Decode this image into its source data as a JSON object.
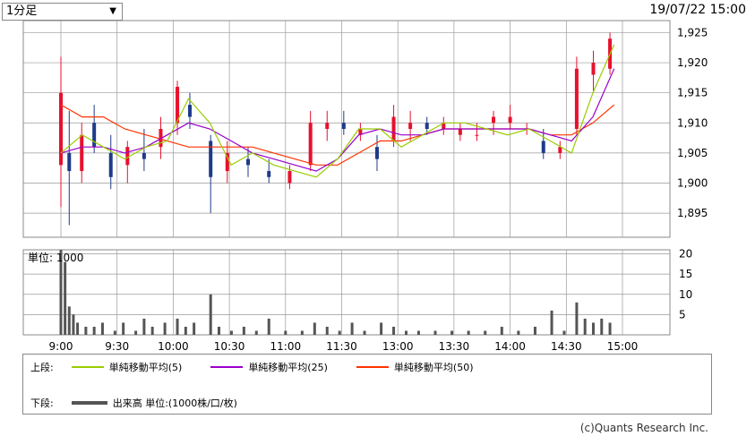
{
  "controls": {
    "interval_select": "1分足",
    "datetime": "19/07/22 15:00"
  },
  "legend": {
    "upper_label": "上段:",
    "lower_label": "下段:",
    "ma5": "単純移動平均(5)",
    "ma25": "単純移動平均(25)",
    "ma50": "単純移動平均(50)",
    "volume": "出来高 単位:(1000株/口/枚)"
  },
  "colors": {
    "up_candle": "#e8112d",
    "down_candle": "#1f3a8a",
    "ma5": "#99cc00",
    "ma25": "#9900cc",
    "ma50": "#ff3300",
    "volume_bar": "#555555",
    "grid": "#999999"
  },
  "credit": "(c)Quants Research Inc.",
  "chart_data": [
    {
      "type": "line",
      "title": "",
      "x_ticks": [
        "9:00",
        "9:30",
        "10:00",
        "10:30",
        "11:00",
        "11:30",
        "13:00",
        "13:30",
        "14:00",
        "14:30",
        "15:00"
      ],
      "y_ticks": [
        "1,895",
        "1,900",
        "1,905",
        "1,910",
        "1,915",
        "1,920",
        "1,925"
      ],
      "ylim": [
        1891,
        1927
      ],
      "grid": true,
      "x": [
        "9:00",
        "9:30",
        "10:00",
        "10:30",
        "11:00",
        "11:30",
        "13:00",
        "13:30",
        "14:00",
        "14:30",
        "15:00"
      ],
      "price_candles": [
        {
          "t": 0,
          "o": 1903,
          "h": 1921,
          "l": 1896,
          "c": 1915
        },
        {
          "t": 2,
          "o": 1905,
          "h": 1912,
          "l": 1893,
          "c": 1902
        },
        {
          "t": 5,
          "o": 1902,
          "h": 1910,
          "l": 1900,
          "c": 1908
        },
        {
          "t": 8,
          "o": 1910,
          "h": 1913,
          "l": 1905,
          "c": 1906
        },
        {
          "t": 12,
          "o": 1905,
          "h": 1908,
          "l": 1899,
          "c": 1901
        },
        {
          "t": 16,
          "o": 1903,
          "h": 1907,
          "l": 1900,
          "c": 1906
        },
        {
          "t": 20,
          "o": 1905,
          "h": 1909,
          "l": 1902,
          "c": 1904
        },
        {
          "t": 24,
          "o": 1906,
          "h": 1911,
          "l": 1904,
          "c": 1909
        },
        {
          "t": 28,
          "o": 1910,
          "h": 1917,
          "l": 1908,
          "c": 1916
        },
        {
          "t": 31,
          "o": 1913,
          "h": 1915,
          "l": 1909,
          "c": 1911
        },
        {
          "t": 36,
          "o": 1907,
          "h": 1908,
          "l": 1895,
          "c": 1901
        },
        {
          "t": 40,
          "o": 1902,
          "h": 1907,
          "l": 1900,
          "c": 1905
        },
        {
          "t": 45,
          "o": 1904,
          "h": 1906,
          "l": 1901,
          "c": 1903
        },
        {
          "t": 50,
          "o": 1902,
          "h": 1904,
          "l": 1900,
          "c": 1901
        },
        {
          "t": 55,
          "o": 1900,
          "h": 1903,
          "l": 1899,
          "c": 1902
        },
        {
          "t": 60,
          "o": 1903,
          "h": 1912,
          "l": 1902,
          "c": 1910
        },
        {
          "t": 64,
          "o": 1909,
          "h": 1912,
          "l": 1907,
          "c": 1910
        },
        {
          "t": 68,
          "o": 1910,
          "h": 1912,
          "l": 1908,
          "c": 1909
        },
        {
          "t": 72,
          "o": 1908,
          "h": 1910,
          "l": 1907,
          "c": 1909
        },
        {
          "t": 76,
          "o": 1906,
          "h": 1908,
          "l": 1902,
          "c": 1904
        },
        {
          "t": 80,
          "o": 1907,
          "h": 1913,
          "l": 1906,
          "c": 1911
        },
        {
          "t": 84,
          "o": 1909,
          "h": 1912,
          "l": 1907,
          "c": 1910
        },
        {
          "t": 88,
          "o": 1910,
          "h": 1911,
          "l": 1908,
          "c": 1909
        },
        {
          "t": 92,
          "o": 1909,
          "h": 1911,
          "l": 1908,
          "c": 1910
        },
        {
          "t": 96,
          "o": 1908,
          "h": 1910,
          "l": 1907,
          "c": 1909
        },
        {
          "t": 100,
          "o": 1908,
          "h": 1910,
          "l": 1907,
          "c": 1908
        },
        {
          "t": 104,
          "o": 1910,
          "h": 1912,
          "l": 1908,
          "c": 1911
        },
        {
          "t": 108,
          "o": 1910,
          "h": 1913,
          "l": 1909,
          "c": 1911
        },
        {
          "t": 112,
          "o": 1909,
          "h": 1910,
          "l": 1908,
          "c": 1909
        },
        {
          "t": 116,
          "o": 1907,
          "h": 1909,
          "l": 1904,
          "c": 1905
        },
        {
          "t": 120,
          "o": 1905,
          "h": 1907,
          "l": 1904,
          "c": 1906
        },
        {
          "t": 124,
          "o": 1909,
          "h": 1921,
          "l": 1908,
          "c": 1919
        },
        {
          "t": 128,
          "o": 1918,
          "h": 1922,
          "l": 1915,
          "c": 1920
        },
        {
          "t": 132,
          "o": 1919,
          "h": 1925,
          "l": 1918,
          "c": 1924
        }
      ],
      "ma5": [
        1905,
        1908,
        1906,
        1904,
        1906,
        1907,
        1914,
        1910,
        1903,
        1905,
        1903,
        1902,
        1901,
        1904,
        1909,
        1909,
        1906,
        1908,
        1910,
        1910,
        1909,
        1908,
        1909,
        1907,
        1905,
        1915,
        1923
      ],
      "ma25": [
        1905,
        1906,
        1906,
        1905,
        1906,
        1908,
        1910,
        1909,
        1907,
        1905,
        1904,
        1903,
        1902,
        1904,
        1908,
        1909,
        1908,
        1908,
        1909,
        1909,
        1909,
        1909,
        1909,
        1908,
        1907,
        1911,
        1919
      ],
      "ma50": [
        1913,
        1911,
        1911,
        1909,
        1908,
        1907,
        1906,
        1906,
        1906,
        1906,
        1905,
        1904,
        1903,
        1903,
        1905,
        1907,
        1907,
        1908,
        1909,
        1909,
        1909,
        1909,
        1909,
        1908,
        1908,
        1910,
        1913
      ]
    },
    {
      "type": "bar",
      "title": "単位: 1000",
      "y_ticks": [
        "5",
        "10",
        "15",
        "20"
      ],
      "ylim": [
        0,
        21
      ],
      "volumes": [
        {
          "t": 0,
          "v": 21
        },
        {
          "t": 1,
          "v": 18
        },
        {
          "t": 2,
          "v": 7
        },
        {
          "t": 3,
          "v": 5
        },
        {
          "t": 4,
          "v": 3
        },
        {
          "t": 6,
          "v": 2
        },
        {
          "t": 8,
          "v": 2
        },
        {
          "t": 10,
          "v": 3
        },
        {
          "t": 13,
          "v": 1
        },
        {
          "t": 15,
          "v": 3
        },
        {
          "t": 18,
          "v": 1
        },
        {
          "t": 20,
          "v": 4
        },
        {
          "t": 22,
          "v": 2
        },
        {
          "t": 25,
          "v": 3
        },
        {
          "t": 28,
          "v": 4
        },
        {
          "t": 30,
          "v": 2
        },
        {
          "t": 32,
          "v": 3
        },
        {
          "t": 36,
          "v": 10
        },
        {
          "t": 38,
          "v": 2
        },
        {
          "t": 41,
          "v": 1
        },
        {
          "t": 44,
          "v": 2
        },
        {
          "t": 47,
          "v": 1
        },
        {
          "t": 50,
          "v": 4
        },
        {
          "t": 54,
          "v": 1
        },
        {
          "t": 58,
          "v": 1
        },
        {
          "t": 61,
          "v": 3
        },
        {
          "t": 64,
          "v": 2
        },
        {
          "t": 67,
          "v": 1
        },
        {
          "t": 70,
          "v": 3
        },
        {
          "t": 73,
          "v": 1
        },
        {
          "t": 77,
          "v": 3
        },
        {
          "t": 80,
          "v": 2
        },
        {
          "t": 83,
          "v": 1
        },
        {
          "t": 86,
          "v": 1
        },
        {
          "t": 90,
          "v": 1
        },
        {
          "t": 94,
          "v": 1
        },
        {
          "t": 98,
          "v": 1
        },
        {
          "t": 102,
          "v": 1
        },
        {
          "t": 106,
          "v": 2
        },
        {
          "t": 110,
          "v": 1
        },
        {
          "t": 114,
          "v": 2
        },
        {
          "t": 118,
          "v": 6
        },
        {
          "t": 121,
          "v": 1
        },
        {
          "t": 124,
          "v": 8
        },
        {
          "t": 126,
          "v": 4
        },
        {
          "t": 128,
          "v": 3
        },
        {
          "t": 130,
          "v": 4
        },
        {
          "t": 132,
          "v": 3
        }
      ]
    }
  ]
}
